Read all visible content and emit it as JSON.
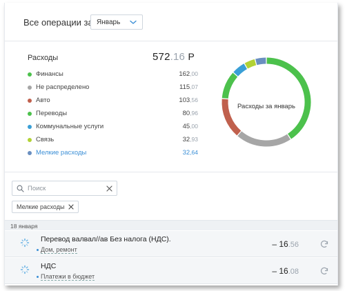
{
  "header": {
    "title": "Все операции за",
    "month_select": {
      "value": "Январь",
      "icon": "chevron-down-icon"
    }
  },
  "summary": {
    "title": "Расходы",
    "total": {
      "int": "572",
      "frac": ".16",
      "currency": "Р"
    },
    "categories": [
      {
        "label": "Финансы",
        "int": "162",
        "frac": ",00",
        "color": "#4cc14c",
        "value": 162.0
      },
      {
        "label": "Не распределено",
        "int": "115",
        "frac": ",07",
        "color": "#a6a6a6",
        "value": 115.07
      },
      {
        "label": "Авто",
        "int": "103",
        "frac": ",56",
        "color": "#c0604d",
        "value": 103.56
      },
      {
        "label": "Переводы",
        "int": "80",
        "frac": ",96",
        "color": "#4cc14c",
        "value": 80.96
      },
      {
        "label": "Коммунальные услуги",
        "int": "45",
        "frac": ",00",
        "color": "#3a9fd6",
        "value": 45.0
      },
      {
        "label": "Связь",
        "int": "32",
        "frac": ",93",
        "color": "#b2d235",
        "value": 32.93
      },
      {
        "label": "Мелкие расходы",
        "int": "32",
        "frac": ",64",
        "color": "#6a8fc0",
        "value": 32.64,
        "link": true
      }
    ],
    "donut": {
      "label": "Расходы за январь",
      "segments": [
        {
          "color": "#4cc14c",
          "value": 158
        },
        {
          "color": "#a6a6a6",
          "value": 80
        },
        {
          "color": "#c0604d",
          "value": 58
        },
        {
          "color": "#4cc14c",
          "value": 40
        },
        {
          "color": "#3a9fd6",
          "value": 20
        },
        {
          "color": "#b2d235",
          "value": 16
        },
        {
          "color": "#6a8fc0",
          "value": 16
        }
      ]
    }
  },
  "filters": {
    "search_placeholder": "Поиск",
    "chip": "Мелкие расходы",
    "icons": {
      "search": "search-icon",
      "clear": "close-icon",
      "chip_remove": "close-icon"
    }
  },
  "date_group": "18 января",
  "transactions": [
    {
      "title": "Перевод валвал//ав Без налога (НДС).",
      "category": "Дом, ремонт",
      "amount_int": "– 16",
      "amount_frac": ".56"
    },
    {
      "title": "НДС",
      "category": "Платежи в бюджет",
      "amount_int": "– 16",
      "amount_frac": ".08"
    }
  ]
}
